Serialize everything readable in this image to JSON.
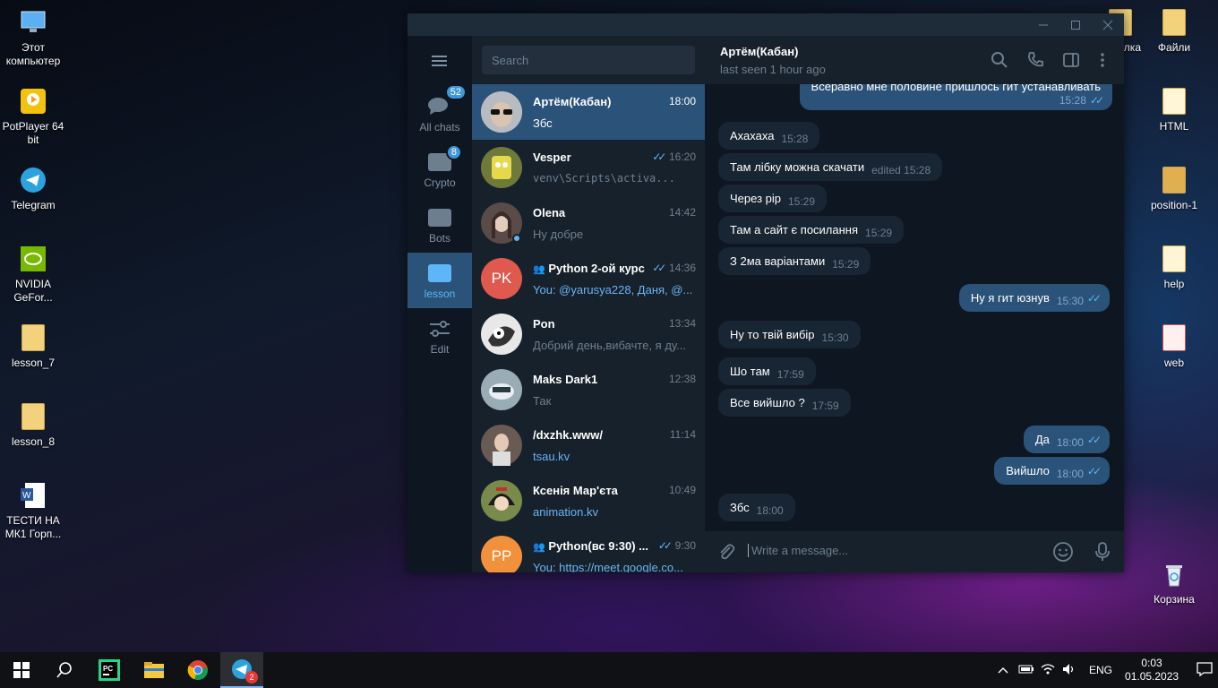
{
  "desktop": {
    "left_icons": [
      {
        "label": "Этот компьютер",
        "icon": "computer-icon"
      },
      {
        "label": "PotPlayer 64 bit",
        "icon": "potplayer-icon"
      },
      {
        "label": "Telegram",
        "icon": "telegram-icon"
      },
      {
        "label": "NVIDIA GeFor...",
        "icon": "nvidia-icon"
      },
      {
        "label": "lesson_7",
        "icon": "folder-icon"
      },
      {
        "label": "lesson_8",
        "icon": "folder-icon"
      },
      {
        "label": "ТЕСТИ НА МК1 Горп...",
        "icon": "word-doc-icon"
      }
    ],
    "right_icons": [
      {
        "label": "лка",
        "icon": "folder-icon"
      },
      {
        "label": "Файли",
        "icon": "folder-icon"
      },
      {
        "label": "HTML",
        "icon": "folder-icon"
      },
      {
        "label": "position-1",
        "icon": "folder-icon"
      },
      {
        "label": "help",
        "icon": "folder-icon"
      },
      {
        "label": "web",
        "icon": "folder-icon"
      },
      {
        "label": "Корзина",
        "icon": "recycle-bin-icon"
      }
    ]
  },
  "telegram": {
    "folders": [
      {
        "label": "All chats",
        "badge": "52",
        "icon": "chats-icon"
      },
      {
        "label": "Crypto",
        "badge": "8",
        "icon": "folder-icon"
      },
      {
        "label": "Bots",
        "badge": "",
        "icon": "folder-icon"
      },
      {
        "label": "lesson",
        "badge": "",
        "icon": "folder-icon",
        "active": true
      },
      {
        "label": "Edit",
        "badge": "",
        "icon": "edit-sliders-icon"
      }
    ],
    "search_placeholder": "Search",
    "chats": [
      {
        "name": "Артём(Кабан)",
        "time": "18:00",
        "preview": "Збс",
        "initials": "",
        "color": "#3a4450",
        "active": true
      },
      {
        "name": "Vesper",
        "time": "16:20",
        "preview": "venv\\Scripts\\activa...",
        "initials": "",
        "color": "#7b7a3a",
        "read": true
      },
      {
        "name": "Olena",
        "time": "14:42",
        "preview": "Ну добре",
        "initials": "",
        "color": "#5a4a48",
        "online": true
      },
      {
        "name": "Python 2-ой курс",
        "time": "14:36",
        "preview": "You: @yarusya228, Даня, @...",
        "initials": "PK",
        "color": "#e0594f",
        "group": true,
        "read": true
      },
      {
        "name": "Pon",
        "time": "13:34",
        "preview": "Добрий день,вибачте, я ду...",
        "initials": "",
        "color": "#d8d8d8"
      },
      {
        "name": "Maks Dark1",
        "time": "12:38",
        "preview": "Так",
        "initials": "",
        "color": "#8ea2ad"
      },
      {
        "name": "/dxzhk.www/",
        "time": "11:14",
        "preview": "tsau.kv",
        "initials": "",
        "color": "#6a5a54",
        "link": true
      },
      {
        "name": "Ксенія Мар'єта",
        "time": "10:49",
        "preview": "animation.kv",
        "initials": "",
        "color": "#8d4a2a",
        "link": true
      },
      {
        "name": "Python(вс 9:30) ...",
        "time": "9:30",
        "preview": "You: https://meet.google.co...",
        "initials": "PP",
        "color": "#f2913c",
        "group": true,
        "read": true
      }
    ],
    "header": {
      "name": "Артём(Кабан)",
      "status": "last seen 1 hour ago"
    },
    "messages": [
      {
        "dir": "out",
        "text": "Всёравно мне половине пришлось гит устанавливать",
        "time": "15:28"
      },
      {
        "dir": "in",
        "text": "Ахахаха",
        "time": "15:28"
      },
      {
        "dir": "in",
        "text": "Там лібку можна скачати",
        "time": "edited 15:28"
      },
      {
        "dir": "in",
        "text": "Через pip",
        "time": "15:29"
      },
      {
        "dir": "in",
        "text": "Там а сайт є посилання",
        "time": "15:29"
      },
      {
        "dir": "in",
        "text": "З 2ма варіантами",
        "time": "15:29"
      },
      {
        "dir": "out",
        "text": "Ну я гит юзнув",
        "time": "15:30"
      },
      {
        "dir": "in",
        "text": "Ну то твій вибір",
        "time": "15:30"
      },
      {
        "dir": "in",
        "text": "Шо там",
        "time": "17:59"
      },
      {
        "dir": "in",
        "text": "Все вийшло ?",
        "time": "17:59"
      },
      {
        "dir": "out",
        "text": "Да",
        "time": "18:00"
      },
      {
        "dir": "out",
        "text": "Вийшло",
        "time": "18:00"
      },
      {
        "dir": "in",
        "text": "Збс",
        "time": "18:00"
      }
    ],
    "composer_placeholder": "Write a message..."
  },
  "taskbar": {
    "telegram_badge": "2",
    "lang": "ENG",
    "time": "0:03",
    "date": "01.05.2023"
  }
}
